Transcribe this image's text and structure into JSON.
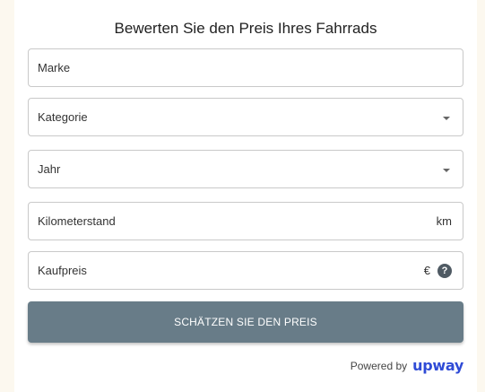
{
  "form": {
    "title": "Bewerten Sie den Preis Ihres Fahrrads",
    "fields": [
      {
        "label": "Marke"
      },
      {
        "label": "Kategorie"
      },
      {
        "label": "Jahr"
      },
      {
        "label": "Kilometerstand",
        "suffix": "km"
      },
      {
        "label": "Kaufpreis",
        "suffix": "€",
        "help": "?"
      }
    ],
    "submit_label": "SCHÄTZEN SIE DEN PREIS"
  },
  "footer": {
    "powered_by": "Powered by",
    "brand": "upway"
  },
  "colors": {
    "background": "#fcf8ef",
    "button": "#687c88",
    "brand": "#2f4bd6"
  },
  "icons": {
    "dropdown": "chevron-down-icon",
    "help": "help-circle-icon"
  }
}
